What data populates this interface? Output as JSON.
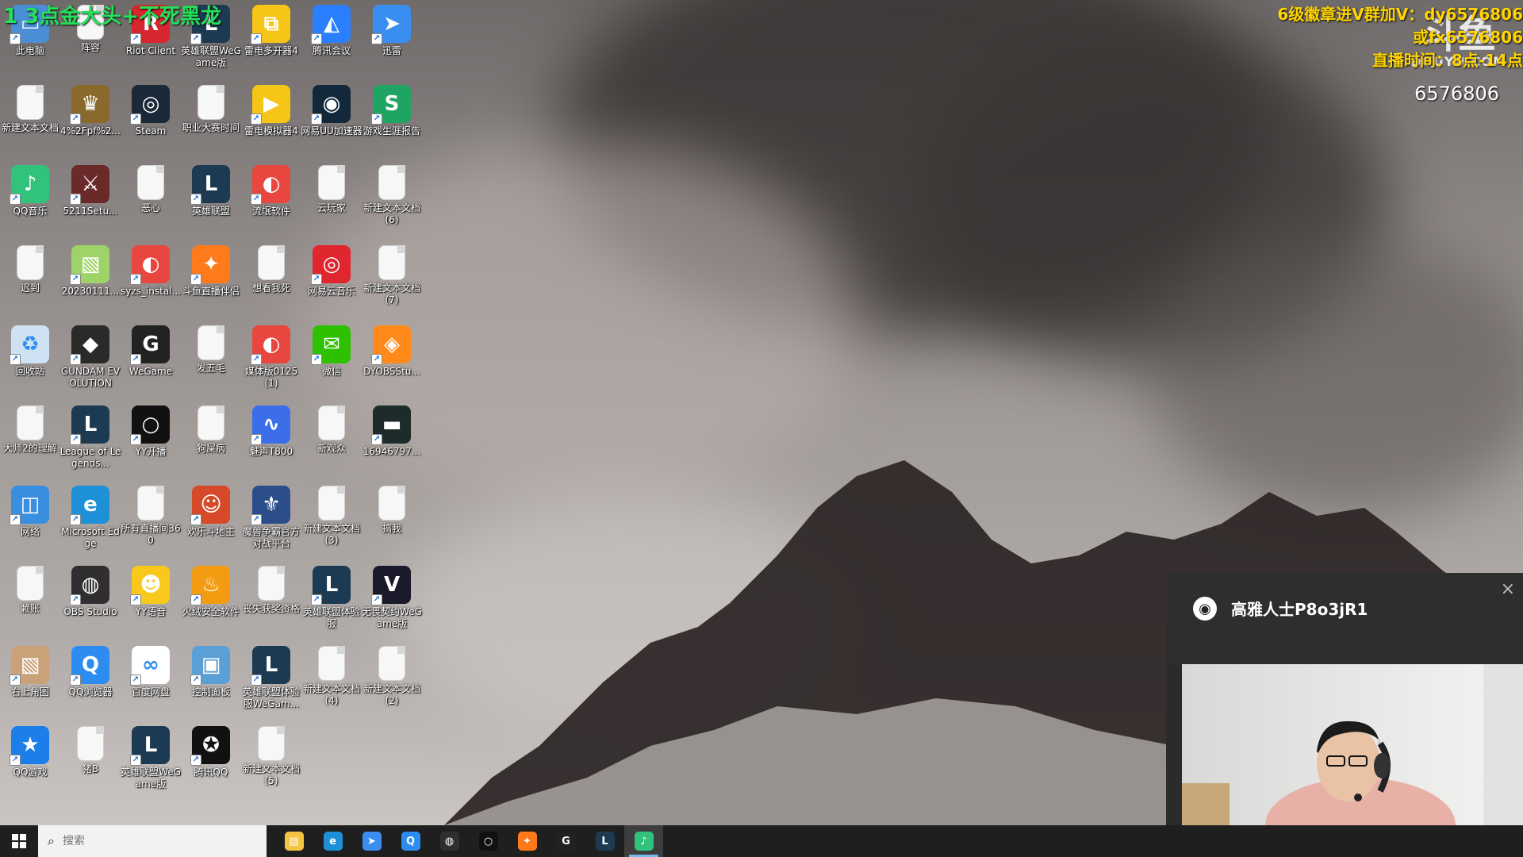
{
  "overlay": {
    "title": "1  3点金大头+不死黑龙",
    "info_line1": "6级徽章进V群加V：dy6576806",
    "info_line2": "或fx6576806",
    "info_line3": "直播时间：8点-14点",
    "room_id": "6576806",
    "logo_glyph": "斗鱼",
    "logo_site": "DOUYU.COM"
  },
  "desktop_icons": [
    {
      "label": "此电脑",
      "icon": "computer-icon",
      "color": "#4a8fd6"
    },
    {
      "label": "阵容",
      "icon": "document-icon",
      "color": "#e0e0e0"
    },
    {
      "label": "Riot Client",
      "icon": "riot-icon",
      "color": "#d7262f"
    },
    {
      "label": "英雄联盟WeGame版",
      "icon": "lol-icon",
      "color": "#1c3a52"
    },
    {
      "label": "雷电多开器4",
      "icon": "ldplayer-multi-icon",
      "color": "#f5c518"
    },
    {
      "label": "腾讯会议",
      "icon": "tencent-meeting-icon",
      "color": "#2a7fff"
    },
    {
      "label": "迅雷",
      "icon": "xunlei-icon",
      "color": "#3a8ef0"
    },
    {
      "label": "新建文本文档",
      "icon": "document-icon",
      "color": "#f7f7f7"
    },
    {
      "label": "4%2Fpf%2...",
      "icon": "game-crest-icon",
      "color": "#8a6a2c"
    },
    {
      "label": "Steam",
      "icon": "steam-icon",
      "color": "#1b2838"
    },
    {
      "label": "职业大赛时间",
      "icon": "document-icon",
      "color": "#f7f7f7"
    },
    {
      "label": "雷电模拟器4",
      "icon": "ldplayer-icon",
      "color": "#f5c518"
    },
    {
      "label": "网易UU加速器",
      "icon": "uu-accelerator-icon",
      "color": "#14283b"
    },
    {
      "label": "游戏生涯报告",
      "icon": "spreadsheet-icon",
      "color": "#1fa463"
    },
    {
      "label": "QQ音乐",
      "icon": "qq-music-icon",
      "color": "#31c27c"
    },
    {
      "label": "5211Setu...",
      "icon": "game-setup-icon",
      "color": "#6b2a2a"
    },
    {
      "label": "恶心",
      "icon": "document-icon",
      "color": "#f7f7f7"
    },
    {
      "label": "英雄联盟",
      "icon": "lol-icon",
      "color": "#1c3a52"
    },
    {
      "label": "流氓软件",
      "icon": "app-red-icon",
      "color": "#e8473f"
    },
    {
      "label": "云玩家",
      "icon": "document-icon",
      "color": "#f7f7f7"
    },
    {
      "label": "新建文本文档(6)",
      "icon": "document-icon",
      "color": "#f7f7f7"
    },
    {
      "label": "迟到",
      "icon": "document-icon",
      "color": "#f7f7f7"
    },
    {
      "label": "20230111...",
      "icon": "image-file-icon",
      "color": "#9ed36a"
    },
    {
      "label": "syzs_instal...",
      "icon": "installer-icon",
      "color": "#e8473f"
    },
    {
      "label": "斗鱼直播伴侣",
      "icon": "douyu-companion-icon",
      "color": "#ff7a1a"
    },
    {
      "label": "想看我死",
      "icon": "document-icon",
      "color": "#f7f7f7"
    },
    {
      "label": "网易云音乐",
      "icon": "netease-music-icon",
      "color": "#e0262f"
    },
    {
      "label": "新建文本文档(7)",
      "icon": "document-icon",
      "color": "#f7f7f7"
    },
    {
      "label": "回收站",
      "icon": "recycle-bin-icon",
      "color": "#cfe2f3"
    },
    {
      "label": "GUNDAM EVOLUTION",
      "icon": "gundam-icon",
      "color": "#2a2a2a"
    },
    {
      "label": "WeGame",
      "icon": "wegame-icon",
      "color": "#222"
    },
    {
      "label": "发五毛",
      "icon": "document-icon",
      "color": "#f7f7f7"
    },
    {
      "label": "媒体版0125(1)",
      "icon": "app-red-icon",
      "color": "#e8473f"
    },
    {
      "label": "微信",
      "icon": "wechat-icon",
      "color": "#2dc100"
    },
    {
      "label": "DYOBSStu...",
      "icon": "dyobs-icon",
      "color": "#ff8a1a"
    },
    {
      "label": "大师2的理解",
      "icon": "document-icon",
      "color": "#f7f7f7"
    },
    {
      "label": "League of Legends...",
      "icon": "lol-icon",
      "color": "#1c3a52"
    },
    {
      "label": "YY开播",
      "icon": "yy-live-icon",
      "color": "#111"
    },
    {
      "label": "狗屎病",
      "icon": "document-icon",
      "color": "#f7f7f7"
    },
    {
      "label": "魅声T800",
      "icon": "audio-wave-icon",
      "color": "#3b6ee8"
    },
    {
      "label": "新观众",
      "icon": "document-icon",
      "color": "#f7f7f7"
    },
    {
      "label": "16946797...",
      "icon": "video-thumbnail-icon",
      "color": "#1d2b2b"
    },
    {
      "label": "网络",
      "icon": "network-icon",
      "color": "#3a8ee0"
    },
    {
      "label": "Microsoft Edge",
      "icon": "edge-icon",
      "color": "#1e90d8"
    },
    {
      "label": "所有直播间360",
      "icon": "document-icon",
      "color": "#f7f7f7"
    },
    {
      "label": "欢乐斗地主",
      "icon": "doudizhu-icon",
      "color": "#d64a2a"
    },
    {
      "label": "魔兽争霸官方对战平台",
      "icon": "warcraft-icon",
      "color": "#2b4e8a"
    },
    {
      "label": "新建文本文档(3)",
      "icon": "document-icon",
      "color": "#f7f7f7"
    },
    {
      "label": "搞我",
      "icon": "document-icon",
      "color": "#f7f7f7"
    },
    {
      "label": "赖账",
      "icon": "document-icon",
      "color": "#f7f7f7"
    },
    {
      "label": "OBS Studio",
      "icon": "obs-icon",
      "color": "#302e31"
    },
    {
      "label": "YY语音",
      "icon": "yy-voice-icon",
      "color": "#f8c81c"
    },
    {
      "label": "火绒安全软件",
      "icon": "huorong-icon",
      "color": "#f39c12"
    },
    {
      "label": "丧失获奖资格",
      "icon": "document-icon",
      "color": "#f7f7f7"
    },
    {
      "label": "英雄联盟体验服",
      "icon": "lol-icon",
      "color": "#1c3a52"
    },
    {
      "label": "无畏契约WeGame版",
      "icon": "valorant-icon",
      "color": "#1a1a2a"
    },
    {
      "label": "右上角图",
      "icon": "image-file-icon",
      "color": "#c9a27a"
    },
    {
      "label": "QQ浏览器",
      "icon": "qq-browser-icon",
      "color": "#2d8cf0"
    },
    {
      "label": "百度网盘",
      "icon": "baidu-netdisk-icon",
      "color": "#ffffff"
    },
    {
      "label": "控制面板",
      "icon": "control-panel-icon",
      "color": "#5aa0d6"
    },
    {
      "label": "英雄联盟体验服WeGam...",
      "icon": "lol-icon",
      "color": "#1c3a52"
    },
    {
      "label": "新建文本文档(4)",
      "icon": "document-icon",
      "color": "#f7f7f7"
    },
    {
      "label": "新建文本文档(2)",
      "icon": "document-icon",
      "color": "#f7f7f7"
    },
    {
      "label": "QQ游戏",
      "icon": "qq-game-icon",
      "color": "#1c7ee8"
    },
    {
      "label": "猪B",
      "icon": "document-icon",
      "color": "#f7f7f7"
    },
    {
      "label": "英雄联盟WeGame版",
      "icon": "lol-icon",
      "color": "#1c3a52"
    },
    {
      "label": "腾讯QQ",
      "icon": "qq-icon",
      "color": "#111"
    },
    {
      "label": "新建文本文档(5)",
      "icon": "document-icon",
      "color": "#f7f7f7"
    }
  ],
  "chat": {
    "username": "高雅人士P8o3jR1",
    "close": "×",
    "avatar_glyph": "◉"
  },
  "taskbar": {
    "search_placeholder": "搜索",
    "search_icon": "⌕",
    "apps": [
      {
        "name": "file-explorer",
        "glyph": "▤",
        "color": "#f4c542",
        "active": false
      },
      {
        "name": "edge",
        "glyph": "e",
        "color": "#1e90d8",
        "active": false
      },
      {
        "name": "xunlei",
        "glyph": "➤",
        "color": "#3a8ef0",
        "active": false
      },
      {
        "name": "qq-browser",
        "glyph": "Q",
        "color": "#2d8cf0",
        "active": false
      },
      {
        "name": "obs",
        "glyph": "◍",
        "color": "#302e31",
        "active": false
      },
      {
        "name": "yy-live",
        "glyph": "○",
        "color": "#111",
        "active": false
      },
      {
        "name": "douyu-companion",
        "glyph": "✦",
        "color": "#ff7a1a",
        "active": false
      },
      {
        "name": "wegame",
        "glyph": "G",
        "color": "#222",
        "active": false
      },
      {
        "name": "league-of-legends",
        "glyph": "L",
        "color": "#1c3a52",
        "active": false
      },
      {
        "name": "qq-music",
        "glyph": "♪",
        "color": "#31c27c",
        "active": true
      }
    ]
  }
}
